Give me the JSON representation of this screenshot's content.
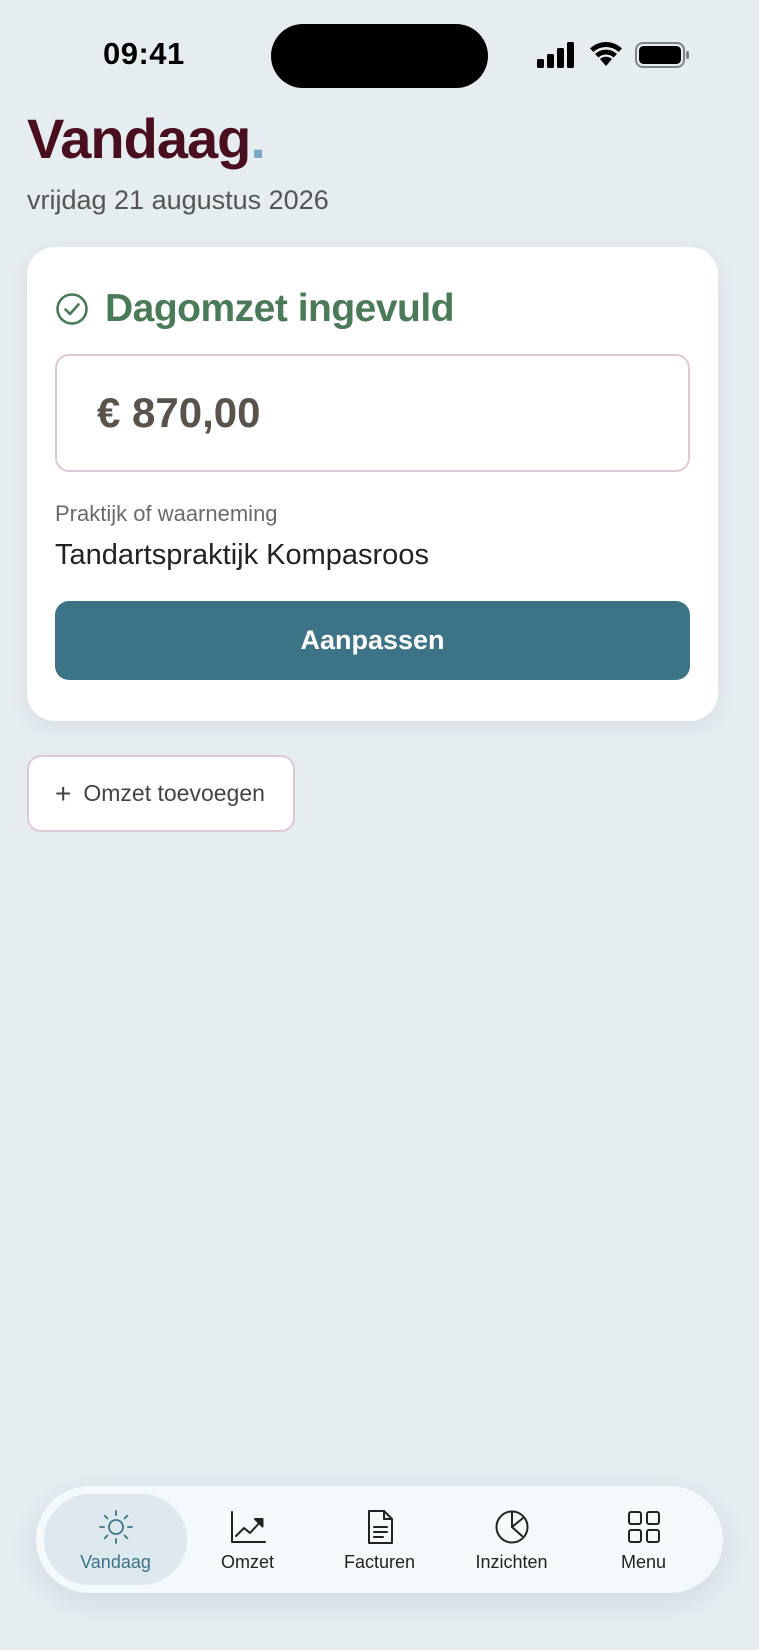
{
  "status_bar": {
    "time": "09:41",
    "icons": [
      "signal-icon",
      "wifi-icon",
      "battery-icon"
    ]
  },
  "header": {
    "title": "Vandaag",
    "title_dot": ".",
    "date": "vrijdag 21 augustus 2026"
  },
  "card": {
    "icon": "check-circle-icon",
    "title": "Dagomzet ingevuld",
    "amount": "€ 870,00",
    "practice_label": "Praktijk of waarneming",
    "practice_value": "Tandartspraktijk Kompasroos",
    "adjust_label": "Aanpassen"
  },
  "add_revenue": {
    "icon": "plus-icon",
    "plus": "+",
    "label": "Omzet toevoegen"
  },
  "tab_bar": {
    "tabs": [
      {
        "label": "Vandaag",
        "icon": "sun-icon",
        "active": true
      },
      {
        "label": "Omzet",
        "icon": "chart-up-icon",
        "active": false
      },
      {
        "label": "Facturen",
        "icon": "document-icon",
        "active": false
      },
      {
        "label": "Inzichten",
        "icon": "pie-chart-icon",
        "active": false
      },
      {
        "label": "Menu",
        "icon": "grid-icon",
        "active": false
      }
    ]
  },
  "colors": {
    "background": "#e6edf1",
    "title": "#4a0f1f",
    "title_dot": "#7aa7c2",
    "success": "#4a7a58",
    "primary": "#3d7386",
    "field_border": "#dcc8d6"
  }
}
